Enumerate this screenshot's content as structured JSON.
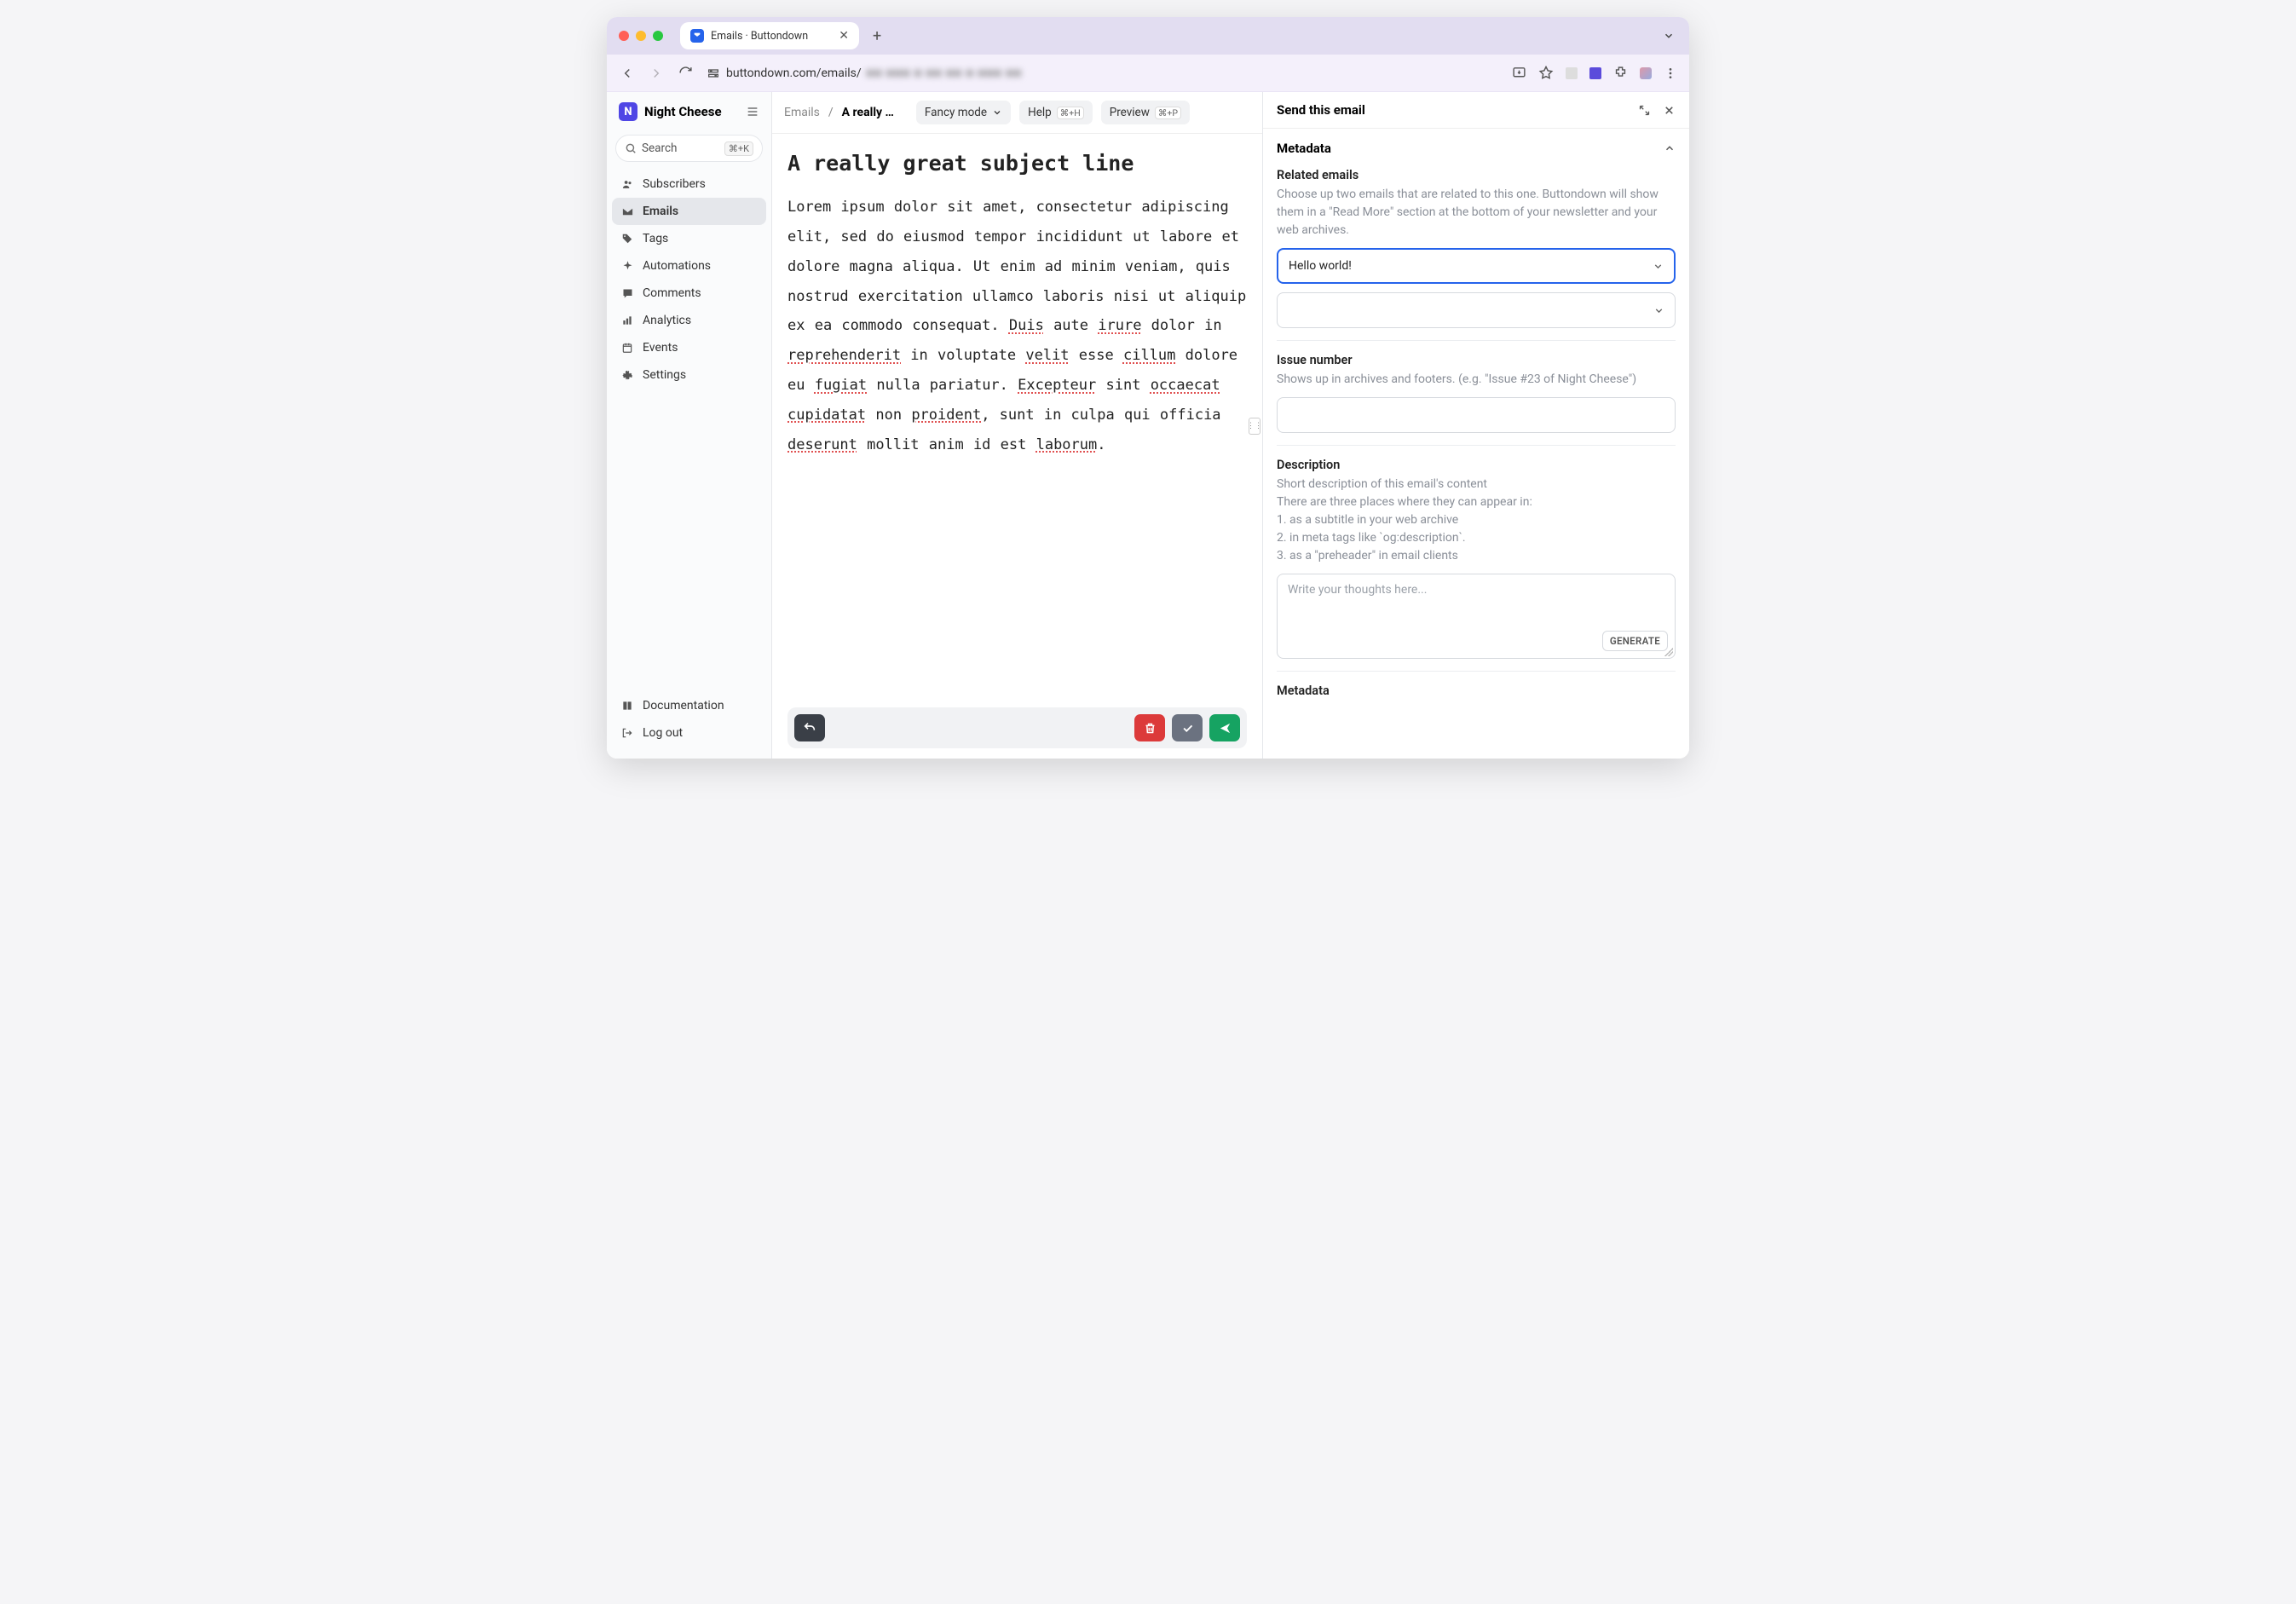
{
  "browser": {
    "tab_title": "Emails · Buttondown",
    "url_prefix": "buttondown.com/emails/",
    "url_blur": "■■  ■■■ ■ ■■ ■■ ■ ■■■  ■■"
  },
  "brand": {
    "name": "Night Cheese",
    "icon_letter": "N"
  },
  "search": {
    "placeholder": "Search",
    "shortcut": "⌘+K"
  },
  "sidebar": {
    "items": [
      {
        "label": "Subscribers"
      },
      {
        "label": "Emails"
      },
      {
        "label": "Tags"
      },
      {
        "label": "Automations"
      },
      {
        "label": "Comments"
      },
      {
        "label": "Analytics"
      },
      {
        "label": "Events"
      },
      {
        "label": "Settings"
      }
    ],
    "footer": [
      {
        "label": "Documentation"
      },
      {
        "label": "Log out"
      }
    ]
  },
  "crumbs": {
    "root": "Emails",
    "current": "A really …"
  },
  "toolbar": {
    "fancy": "Fancy mode",
    "help": "Help",
    "help_kbd": "⌘+H",
    "preview": "Preview",
    "preview_kbd": "⌘+P"
  },
  "editor": {
    "subject": "A really great subject line",
    "body_parts": [
      {
        "t": "Lorem ipsum dolor sit amet, consectetur adipiscing elit, sed do eiusmod tempor incididunt ut labore et dolore magna aliqua. Ut enim ad minim veniam, quis nostrud exercitation ullamco laboris nisi ut aliquip ex ea commodo consequat. "
      },
      {
        "t": "Duis",
        "u": true
      },
      {
        "t": " aute "
      },
      {
        "t": "irure",
        "u": true
      },
      {
        "t": " dolor in "
      },
      {
        "t": "reprehenderit",
        "u": true
      },
      {
        "t": " in voluptate "
      },
      {
        "t": "velit",
        "u": true
      },
      {
        "t": " esse "
      },
      {
        "t": "cillum",
        "u": true
      },
      {
        "t": " dolore eu "
      },
      {
        "t": "fugiat",
        "u": true
      },
      {
        "t": " nulla pariatur. "
      },
      {
        "t": "Excepteur",
        "u": true
      },
      {
        "t": " sint "
      },
      {
        "t": "occaecat",
        "u": true
      },
      {
        "t": " "
      },
      {
        "t": "cupidatat",
        "u": true
      },
      {
        "t": " non "
      },
      {
        "t": "proident",
        "u": true
      },
      {
        "t": ", sunt in culpa qui officia "
      },
      {
        "t": "deserunt",
        "u": true
      },
      {
        "t": " mollit anim id est "
      },
      {
        "t": "laborum",
        "u": true
      },
      {
        "t": "."
      }
    ]
  },
  "panel": {
    "title": "Send this email",
    "metadata_heading": "Metadata",
    "related": {
      "label": "Related emails",
      "help": "Choose up two emails that are related to this one. Buttondown will show them in a \"Read More\" section at the bottom of your newsletter and your web archives.",
      "selected": "Hello world!"
    },
    "issue": {
      "label": "Issue number",
      "help": "Shows up in archives and footers. (e.g. \"Issue #23 of Night Cheese\")",
      "value": ""
    },
    "description": {
      "label": "Description",
      "help1": "Short description of this email's content",
      "help2": "There are three places where they can appear in:",
      "help3": "1. as a subtitle in your web archive",
      "help4": "2. in meta tags like `og:description`.",
      "help5": "3. as a \"preheader\" in email clients",
      "placeholder": "Write your thoughts here...",
      "generate": "GENERATE"
    },
    "metadata2_heading": "Metadata"
  }
}
